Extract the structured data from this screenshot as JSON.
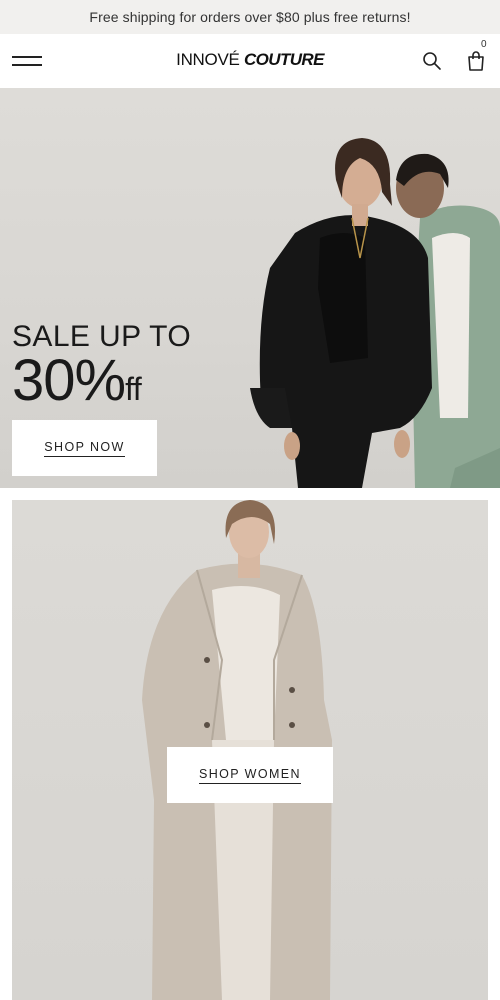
{
  "announcement": {
    "text": "Free shipping for orders over $80 plus free returns!"
  },
  "header": {
    "logo_part1": "INNOVÉ",
    "logo_part2": "COUTURE",
    "cart_count": "0",
    "icons": {
      "menu": "hamburger-menu-icon",
      "search": "search-icon",
      "cart": "shopping-bag-icon"
    }
  },
  "hero": {
    "sale_line1": "SALE UP TO",
    "sale_percent": "30%",
    "sale_suffix": "ff",
    "cta_label": "SHOP NOW"
  },
  "women": {
    "cta_label": "SHOP WOMEN"
  },
  "colors": {
    "announcement_bg": "#f1f0ee",
    "hero_bg": "#dedcd8",
    "button_bg": "#ffffff",
    "text": "#222222"
  }
}
